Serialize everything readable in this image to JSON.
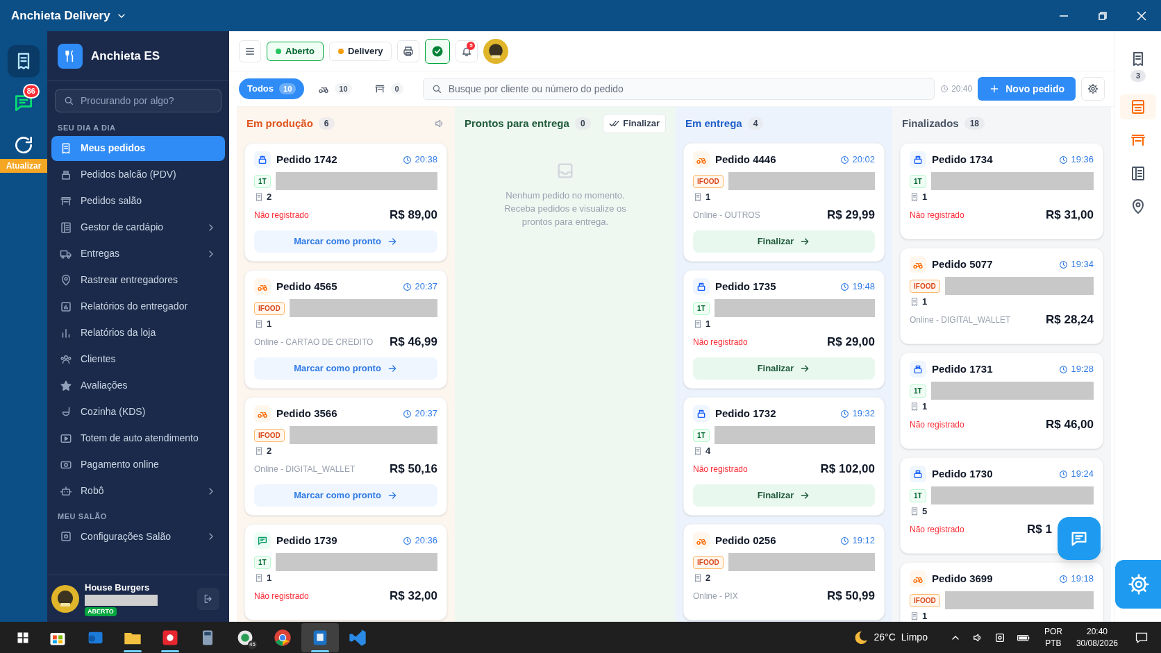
{
  "window": {
    "title": "Anchieta Delivery"
  },
  "rail": [
    {
      "kind": "orders",
      "selected": true
    },
    {
      "kind": "whatsapp",
      "badge": "86",
      "selected": false
    },
    {
      "kind": "refresh",
      "label": "Atualizar",
      "selected": false
    }
  ],
  "sidebar": {
    "brand": "Anchieta ES",
    "search_placeholder": "Procurando por algo?",
    "sections": [
      {
        "title": "SEU DIA A DIA",
        "items": [
          {
            "kind": "orders",
            "label": "Meus pedidos",
            "selected": true,
            "submenu": false
          },
          {
            "kind": "pos",
            "label": "Pedidos balcão (PDV)",
            "selected": false,
            "submenu": false
          },
          {
            "kind": "salon",
            "label": "Pedidos salão",
            "selected": false,
            "submenu": false
          },
          {
            "kind": "menu",
            "label": "Gestor de cardápio",
            "selected": false,
            "submenu": true
          },
          {
            "kind": "deliveries",
            "label": "Entregas",
            "selected": false,
            "submenu": true
          },
          {
            "kind": "track",
            "label": "Rastrear entregadores",
            "selected": false,
            "submenu": false
          },
          {
            "kind": "courier_reports",
            "label": "Relatórios do entregador",
            "selected": false,
            "submenu": false
          },
          {
            "kind": "store_reports",
            "label": "Relatórios da loja",
            "selected": false,
            "submenu": false
          },
          {
            "kind": "clients",
            "label": "Clientes",
            "selected": false,
            "submenu": false
          },
          {
            "kind": "reviews",
            "label": "Avaliações",
            "selected": false,
            "submenu": false
          },
          {
            "kind": "kitchen",
            "label": "Cozinha (KDS)",
            "selected": false,
            "submenu": false
          },
          {
            "kind": "kiosk",
            "label": "Totem de auto atendimento",
            "selected": false,
            "submenu": false
          },
          {
            "kind": "payment",
            "label": "Pagamento online",
            "selected": false,
            "submenu": false
          },
          {
            "kind": "robot",
            "label": "Robô",
            "selected": false,
            "submenu": true
          }
        ]
      },
      {
        "title": "MEU SALÃO",
        "items": [
          {
            "kind": "salon_settings",
            "label": "Configurações Salão",
            "selected": false,
            "submenu": true
          }
        ]
      }
    ],
    "footer": {
      "name": "House Burgers",
      "status": "ABERTO"
    }
  },
  "toolbar": {
    "pills": [
      {
        "label": "Aberto",
        "color": "#22c55e",
        "kind": "open"
      },
      {
        "label": "Delivery",
        "color": "#f59e0b",
        "kind": "plain"
      }
    ],
    "notifications": "5"
  },
  "filters": [
    {
      "kind": "all",
      "label": "Todos",
      "count": "10",
      "selected": true
    },
    {
      "kind": "delivery",
      "count": "10",
      "selected": false
    },
    {
      "kind": "table",
      "count": "0",
      "selected": false
    }
  ],
  "search": {
    "placeholder": "Busque por cliente ou número do pedido"
  },
  "clock": "20:40",
  "new_order": "Novo pedido",
  "columns": [
    {
      "kind": "production",
      "title": "Em produção",
      "count": "6",
      "cards": [
        {
          "kind": "table",
          "title": "Pedido 1742",
          "time": "20:38",
          "badge": "1T",
          "items": "2",
          "payment": "Não registrado",
          "paid": false,
          "price": "R$ 89,00",
          "action": "Marcar como pronto"
        },
        {
          "kind": "ifood",
          "title": "Pedido 4565",
          "time": "20:37",
          "badge": "IFOOD",
          "items": "1",
          "payment": "Online - CARTAO DE CREDITO",
          "paid": true,
          "price": "R$ 46,99",
          "action": "Marcar como pronto"
        },
        {
          "kind": "ifood",
          "title": "Pedido 3566",
          "time": "20:37",
          "badge": "IFOOD",
          "items": "2",
          "payment": "Online - DIGITAL_WALLET",
          "paid": true,
          "price": "R$ 50,16",
          "action": "Marcar como pronto"
        },
        {
          "kind": "chat",
          "title": "Pedido 1739",
          "time": "20:36",
          "badge": "1T",
          "items": "1",
          "payment": "Não registrado",
          "paid": false,
          "price": "R$ 32,00"
        }
      ]
    },
    {
      "kind": "ready",
      "title": "Prontos para entrega",
      "count": "0",
      "action": "Finalizar",
      "empty": "Nenhum pedido no momento. Receba pedidos e visualize os prontos para entrega."
    },
    {
      "kind": "delivery",
      "title": "Em entrega",
      "count": "4",
      "cards": [
        {
          "kind": "ifood",
          "title": "Pedido 4446",
          "time": "20:02",
          "badge": "IFOOD",
          "items": "1",
          "payment": "Online - OUTROS",
          "paid": true,
          "price": "R$ 29,99",
          "action": "Finalizar"
        },
        {
          "kind": "table",
          "title": "Pedido 1735",
          "time": "19:48",
          "badge": "1T",
          "items": "1",
          "payment": "Não registrado",
          "paid": false,
          "price": "R$ 29,00",
          "action": "Finalizar"
        },
        {
          "kind": "table",
          "title": "Pedido 1732",
          "time": "19:32",
          "badge": "1T",
          "items": "4",
          "payment": "Não registrado",
          "paid": false,
          "price": "R$ 102,00",
          "action": "Finalizar"
        },
        {
          "kind": "ifood",
          "title": "Pedido 0256",
          "time": "19:12",
          "badge": "IFOOD",
          "items": "2",
          "payment": "Online - PIX",
          "paid": true,
          "price": "R$ 50,99"
        }
      ]
    },
    {
      "kind": "done",
      "title": "Finalizados",
      "count": "18",
      "cards": [
        {
          "kind": "table",
          "title": "Pedido 1734",
          "time": "19:36",
          "badge": "1T",
          "items": "1",
          "payment": "Não registrado",
          "paid": false,
          "price": "R$ 31,00"
        },
        {
          "kind": "ifood",
          "title": "Pedido 5077",
          "time": "19:34",
          "badge": "IFOOD",
          "items": "1",
          "payment": "Online - DIGITAL_WALLET",
          "paid": true,
          "price": "R$ 28,24"
        },
        {
          "kind": "table",
          "title": "Pedido 1731",
          "time": "19:28",
          "badge": "1T",
          "items": "1",
          "payment": "Não registrado",
          "paid": false,
          "price": "R$ 46,00"
        },
        {
          "kind": "table",
          "title": "Pedido 1730",
          "time": "19:24",
          "badge": "1T",
          "items": "5",
          "payment": "Não registrado",
          "paid": false,
          "price": "R$ 1",
          "covered": true
        },
        {
          "kind": "ifood",
          "title": "Pedido 3699",
          "time": "19:18",
          "badge": "IFOOD",
          "items": "1"
        }
      ]
    }
  ],
  "right_rail": [
    {
      "kind": "orders",
      "badge": "3",
      "selected": false
    },
    {
      "kind": "list",
      "selected": true
    },
    {
      "kind": "table",
      "selected": false
    },
    {
      "kind": "book",
      "selected": false
    },
    {
      "kind": "pin",
      "selected": false
    }
  ],
  "taskbar": {
    "apps": [
      {
        "kind": "store",
        "running": false,
        "selected": false
      },
      {
        "kind": "mail",
        "running": false,
        "selected": false
      },
      {
        "kind": "folder",
        "running": true,
        "selected": false
      },
      {
        "kind": "red",
        "running": true,
        "selected": false
      },
      {
        "kind": "calc",
        "running": false,
        "selected": false
      },
      {
        "kind": "whatsapp",
        "badge": "45",
        "running": false,
        "selected": false
      },
      {
        "kind": "chrome",
        "running": false,
        "selected": false
      },
      {
        "kind": "app",
        "running": true,
        "selected": true
      },
      {
        "kind": "vscode",
        "running": false,
        "selected": false
      }
    ],
    "temperature": "26°C",
    "weather": "Limpo",
    "lang": "POR",
    "layout": "PTB",
    "time": "20:40",
    "date": "30/08/2026"
  }
}
